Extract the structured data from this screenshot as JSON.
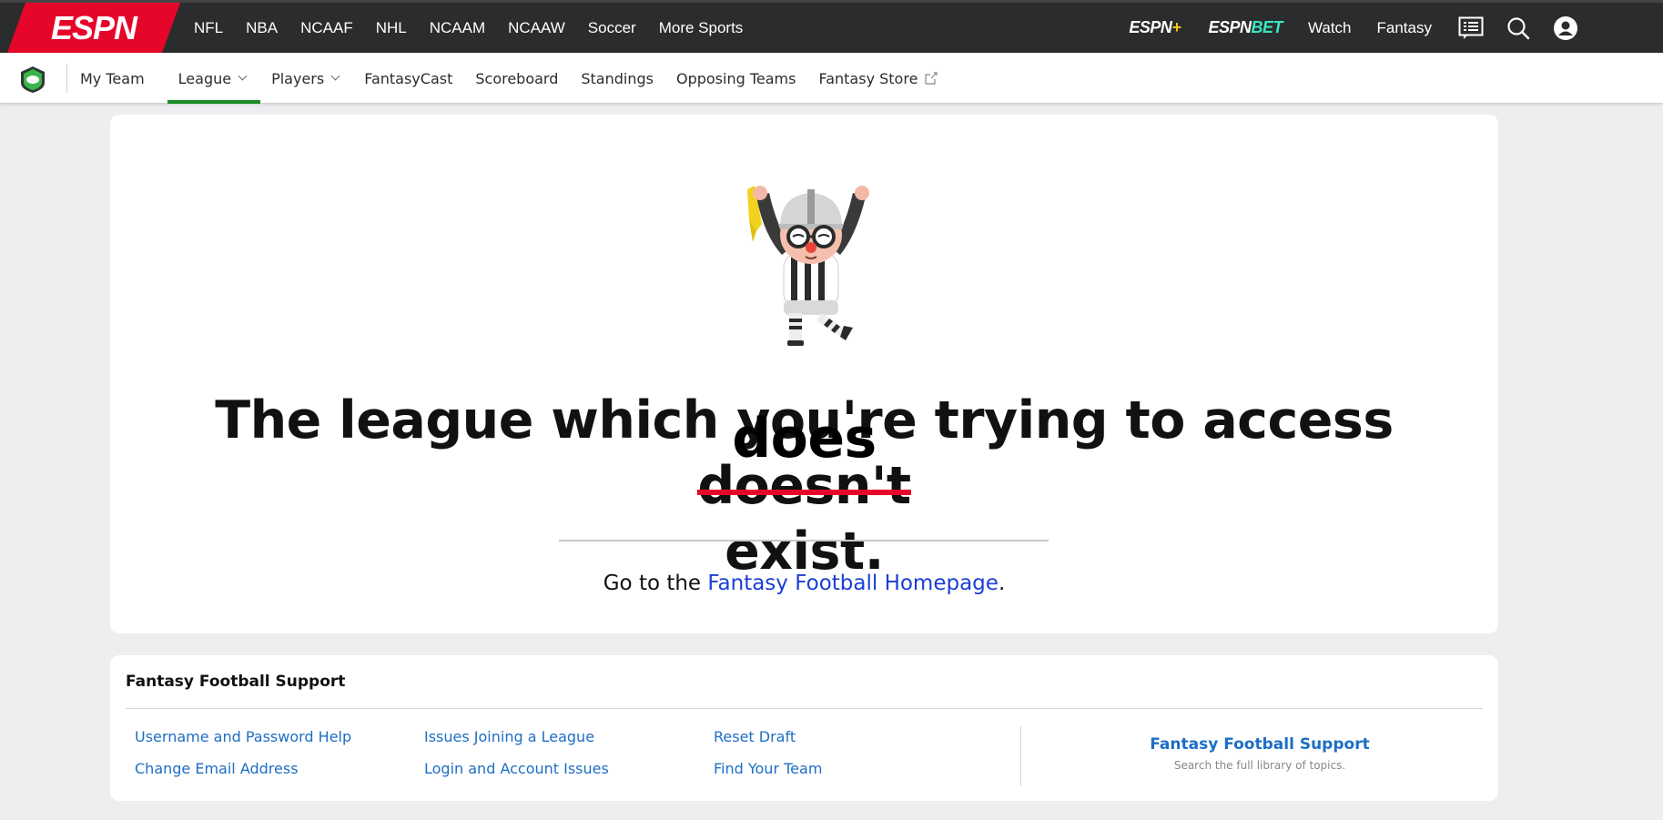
{
  "top_nav": {
    "logo_text": "ESPN",
    "links": [
      "NFL",
      "NBA",
      "NCAAF",
      "NHL",
      "NCAAM",
      "NCAAW",
      "Soccer",
      "More Sports"
    ],
    "espn_plus": {
      "brand": "ESPN",
      "suffix": "+"
    },
    "espn_bet": {
      "brand": "ESPN",
      "suffix": "BET"
    },
    "watch_label": "Watch",
    "fantasy_label": "Fantasy",
    "icons": [
      "scores-icon",
      "search-icon",
      "account-icon"
    ]
  },
  "sub_nav": {
    "logo_icon": "fantasy-football-shield-icon",
    "links": {
      "my_team": "My Team",
      "league": "League",
      "players": "Players",
      "fantasycast": "FantasyCast",
      "scoreboard": "Scoreboard",
      "standings": "Standings",
      "opposing_teams": "Opposing Teams",
      "fantasy_store": "Fantasy Store"
    },
    "active": "League"
  },
  "error": {
    "illustration": "referee-throwing-flag",
    "headline_before": "The league which you're trying to access",
    "struck_word": "doesn't",
    "correction_word": "does",
    "headline_after": "exist.",
    "goto_prefix": "Go to the",
    "goto_link": "Fantasy Football Homepage",
    "goto_suffix": "."
  },
  "support": {
    "title": "Fantasy Football Support",
    "col1": [
      "Username and Password Help",
      "Change Email Address"
    ],
    "col2": [
      "Issues Joining a League",
      "Login and Account Issues"
    ],
    "col3": [
      "Reset Draft",
      "Find Your Team"
    ],
    "right_title": "Fantasy Football Support",
    "right_subtitle": "Search the full library of topics."
  },
  "colors": {
    "top_bar": "#2b2c2d",
    "espn_red": "#e6062a",
    "active_tab": "#1a8c2a",
    "link_blue": "#1a3fd6",
    "support_blue": "#1d6ec5",
    "strike_red": "#e6062a"
  }
}
